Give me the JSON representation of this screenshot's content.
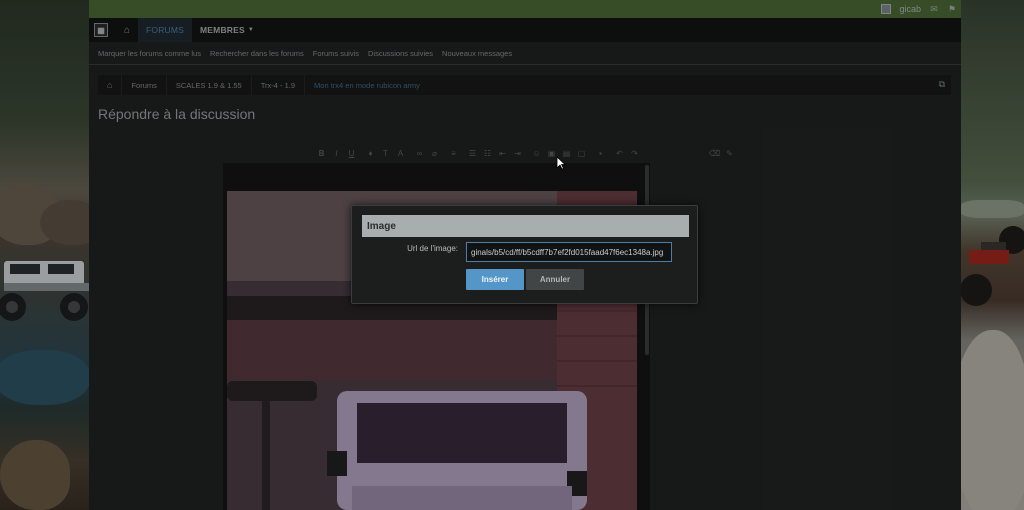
{
  "topbar": {
    "username": "gicab",
    "icons": [
      "avatar-icon",
      "mail-icon",
      "flag-icon"
    ]
  },
  "navbar": {
    "logo_icon": "forum-logo-icon",
    "home_icon": "home-icon",
    "tabs": [
      {
        "label": "FORUMS",
        "active": true
      },
      {
        "label": "MEMBRES",
        "active": false
      }
    ],
    "colors": {
      "active_tab": "#4f84ac"
    }
  },
  "subnav": {
    "links": [
      "Marquer les forums comme lus",
      "Rechercher dans les forums",
      "Forums suivis",
      "Discussions suivies",
      "Nouveaux messages"
    ]
  },
  "breadcrumb": {
    "items": [
      "Forums",
      "SCALES 1.9 & 1.55",
      "Trx-4 - 1.9"
    ],
    "current": "Mon trx4 en mode rubicon army",
    "end_icon": "sitemap-icon"
  },
  "page": {
    "title": "Répondre à la discussion"
  },
  "editor_toolbar": {
    "buttons": [
      "bold-icon",
      "italic-icon",
      "underline-icon",
      "font-color-icon",
      "font-size-icon",
      "font-family-icon",
      "link-icon",
      "unlink-icon",
      "align-icon",
      "bullet-list-icon",
      "number-list-icon",
      "outdent-icon",
      "indent-icon",
      "smilies-icon",
      "image-icon",
      "media-icon",
      "code-icon",
      "save-draft-icon",
      "undo-icon",
      "redo-icon",
      "remove-format-icon",
      "toggle-bbcode-icon"
    ]
  },
  "modal": {
    "title": "Image",
    "url_label": "Url de l'image:",
    "url_value": "ginals/b5/cd/ff/b5cdff7b7ef2fd015faad47f6ec1348a.jpg",
    "insert_label": "Insérer",
    "cancel_label": "Annuler",
    "colors": {
      "insert": "#5596c8",
      "header": "#a8aeae"
    }
  }
}
